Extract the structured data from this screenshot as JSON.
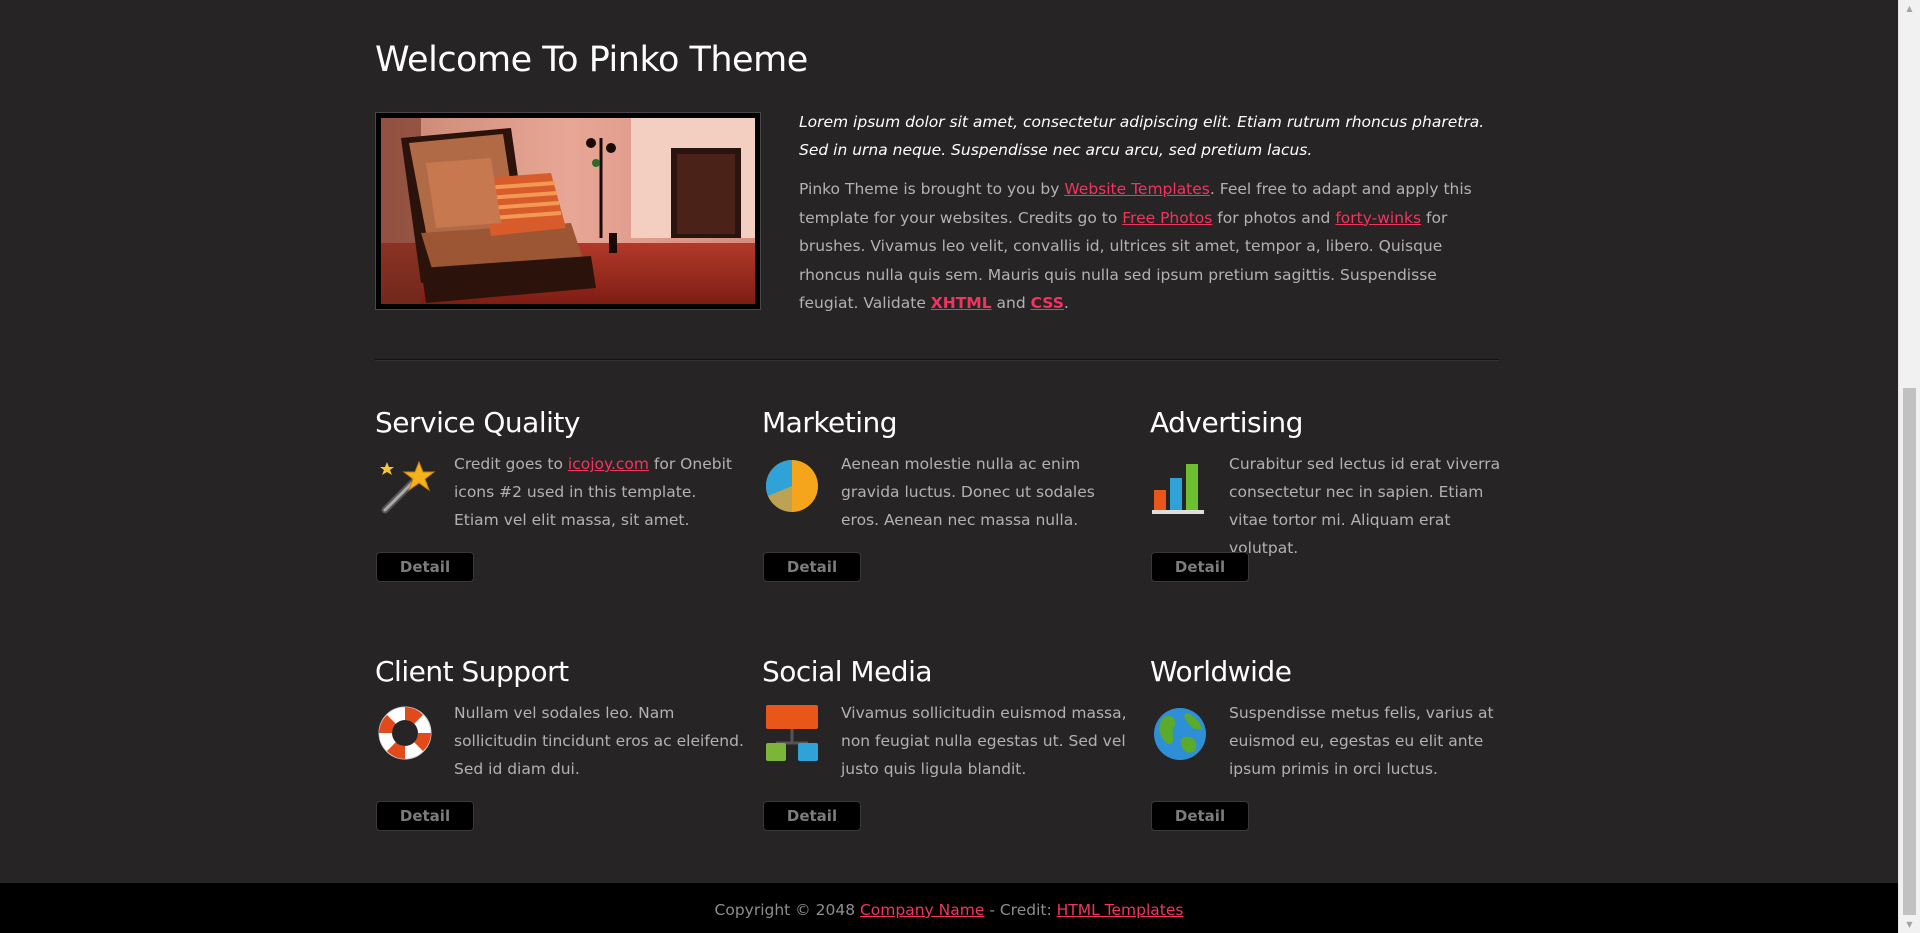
{
  "intro": {
    "title": "Welcome To Pinko Theme",
    "lead": "Lorem ipsum dolor sit amet, consectetur adipiscing elit. Etiam rutrum rhoncus pharetra. Sed in urna neque. Suspendisse nec arcu arcu, sed pretium lacus.",
    "body_1": "Pinko Theme is brought to you by ",
    "link_website_templates": "Website Templates",
    "body_2": ". Feel free to adapt and apply this template for your websites. Credits go to ",
    "link_free_photos": "Free Photos",
    "body_3": " for photos and ",
    "link_forty_winks": "forty-winks",
    "body_4": " for brushes. Vivamus leo velit, convallis id, ultrices sit amet, tempor a, libero. Quisque rhoncus nulla quis sem. Mauris quis nulla sed ipsum pretium sagittis. Suspendisse feugiat. Validate ",
    "link_xhtml": "XHTML",
    "body_5": " and ",
    "link_css": "CSS",
    "body_6": "."
  },
  "services": [
    {
      "title": "Service Quality",
      "icon": "magic-wand-icon",
      "text_before": "Credit goes to ",
      "link": "icojoy.com",
      "text_after": " for Onebit icons #2 used in this template. Etiam vel elit massa, sit amet.",
      "button": "Detail"
    },
    {
      "title": "Marketing",
      "icon": "pie-chart-icon",
      "text": "Aenean molestie nulla ac enim gravida luctus. Donec ut sodales eros. Aenean nec massa nulla.",
      "button": "Detail"
    },
    {
      "title": "Advertising",
      "icon": "bar-chart-icon",
      "text": "Curabitur sed lectus id erat viverra consectetur nec in sapien. Etiam vitae tortor mi. Aliquam erat volutpat.",
      "button": "Detail"
    },
    {
      "title": "Client Support",
      "icon": "lifebuoy-icon",
      "text": "Nullam vel sodales leo. Nam sollicitudin tincidunt eros ac eleifend. Sed id diam dui.",
      "button": "Detail"
    },
    {
      "title": "Social Media",
      "icon": "network-icon",
      "text": "Vivamus sollicitudin euismod massa, non feugiat nulla egestas ut. Sed vel justo quis ligula blandit.",
      "button": "Detail"
    },
    {
      "title": "Worldwide",
      "icon": "globe-icon",
      "text": "Suspendisse metus felis, varius at euismod eu, egestas eu elit ante ipsum primis in orci luctus.",
      "button": "Detail"
    }
  ],
  "footer": {
    "copyright": "Copyright © 2048 ",
    "company_link": "Company Name",
    "credit_text": " - Credit: ",
    "credit_link": "HTML Templates"
  },
  "colors": {
    "background": "#262425",
    "link": "#f2345f",
    "heading": "#ffffff",
    "body_text": "#b3b1b2",
    "footer_bg": "#000000"
  }
}
